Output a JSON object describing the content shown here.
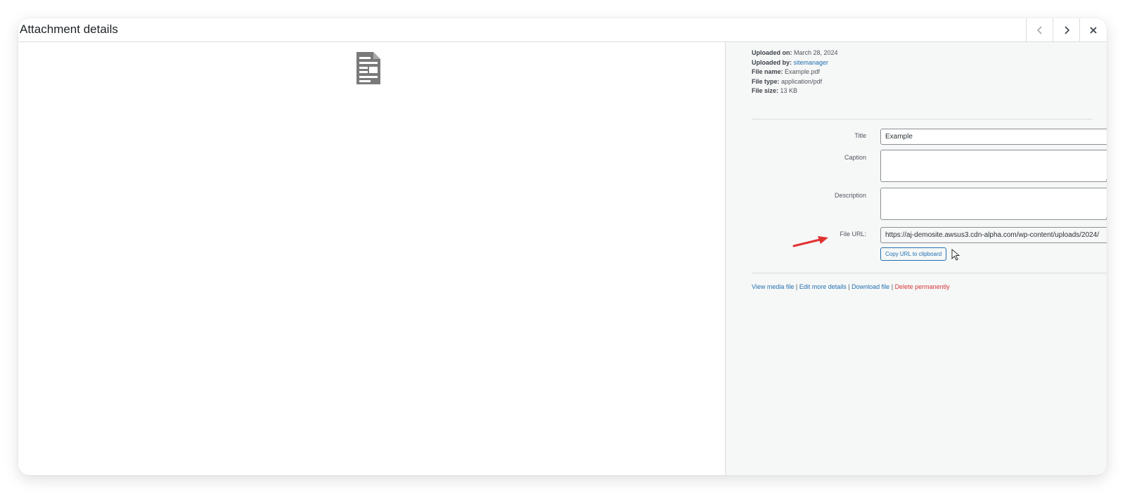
{
  "header": {
    "title": "Attachment details",
    "prev_icon": "chevron-left-icon",
    "next_icon": "chevron-right-icon",
    "close_icon": "close-icon"
  },
  "preview": {
    "icon": "document-icon"
  },
  "details": {
    "uploaded_on": {
      "label": "Uploaded on:",
      "value": "March 28, 2024"
    },
    "uploaded_by": {
      "label": "Uploaded by:",
      "value": "sitemanager"
    },
    "file_name": {
      "label": "File name:",
      "value": "Example.pdf"
    },
    "file_type": {
      "label": "File type:",
      "value": "application/pdf"
    },
    "file_size": {
      "label": "File size:",
      "value": "13 KB"
    }
  },
  "form": {
    "title_label": "Title",
    "title_value": "Example",
    "caption_label": "Caption",
    "caption_value": "",
    "description_label": "Description",
    "description_value": "",
    "url_label": "File URL:",
    "url_value": "https://aj-demosite.awsus3.cdn-alpha.com/wp-content/uploads/2024/",
    "copy_button": "Copy URL to clipboard"
  },
  "actions": {
    "view": "View media file",
    "edit": "Edit more details",
    "download": "Download file",
    "delete": "Delete permanently",
    "separator": "|"
  },
  "colors": {
    "link": "#2271b1",
    "delete": "#d63638",
    "annotation_arrow": "#e03131"
  }
}
